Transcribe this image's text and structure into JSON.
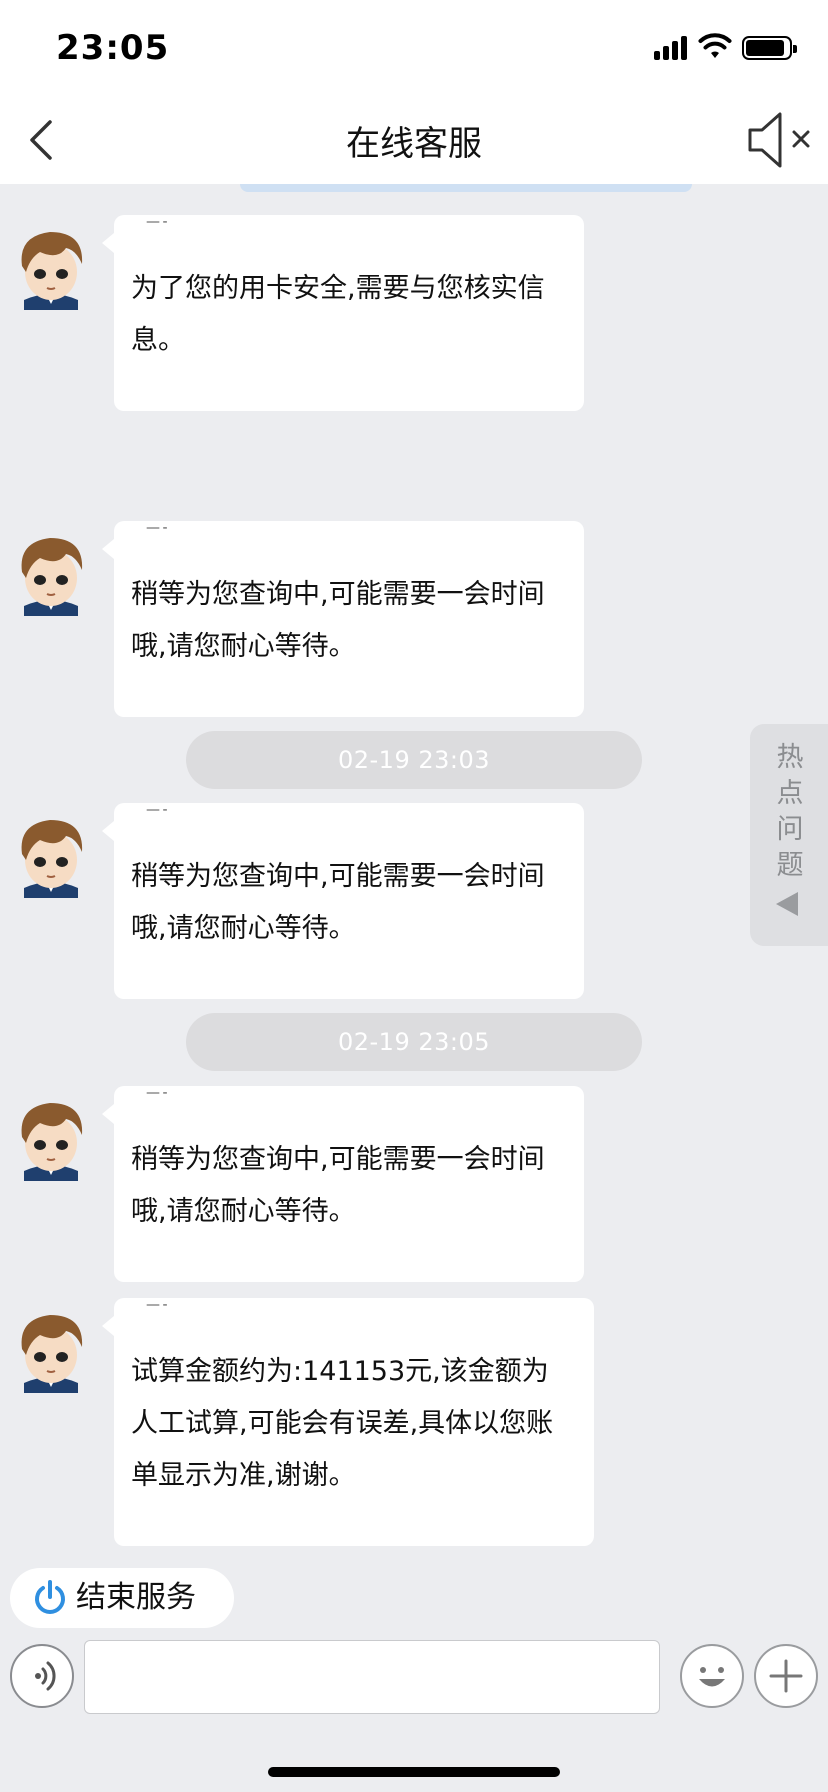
{
  "status_bar": {
    "time": "23:05"
  },
  "nav": {
    "title": "在线客服",
    "back_icon": "chevron-left-icon",
    "mute_icon": "speaker-mute-icon"
  },
  "messages": [
    {
      "text": "为了您的用卡安全,需要与您核实信息。"
    },
    {
      "text": "稍等为您查询中,可能需要一会时间哦,请您耐心等待。"
    },
    {
      "text": "稍等为您查询中,可能需要一会时间哦,请您耐心等待。"
    },
    {
      "text": "稍等为您查询中,可能需要一会时间哦,请您耐心等待。"
    },
    {
      "text": "试算金额约为:141153元,该金额为人工试算,可能会有误差,具体以您账单显示为准,谢谢。"
    }
  ],
  "timestamps": [
    "02-19 23:03",
    "02-19 23:05"
  ],
  "hot_questions": {
    "label": "热点问题"
  },
  "end_service": {
    "label": "结束服务",
    "icon": "power-icon"
  },
  "input": {
    "value": "",
    "placeholder": ""
  },
  "colors": {
    "background": "#ecedf0",
    "bubble": "#ffffff",
    "accent": "#2f8fe0",
    "timestamp_pill": "#dcdcde"
  }
}
